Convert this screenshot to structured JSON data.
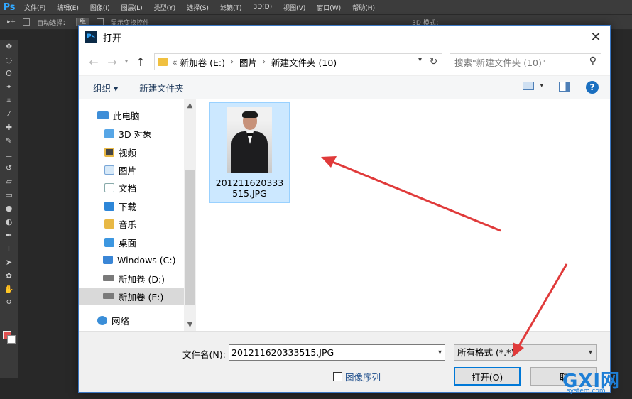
{
  "photoshop": {
    "logo": "Ps",
    "menu": [
      "文件(F)",
      "编辑(E)",
      "图像(I)",
      "图层(L)",
      "类型(Y)",
      "选择(S)",
      "滤镜(T)",
      "3D(D)",
      "视图(V)",
      "窗口(W)",
      "帮助(H)"
    ],
    "options": {
      "auto_select": "自动选择：",
      "auto_select_value": "组",
      "transform": "显示变换控件",
      "mode3d": "3D 模式："
    },
    "colors": {
      "foreground": "#e05050",
      "background": "#ffffff"
    }
  },
  "dialog": {
    "title": "打开",
    "close": "✕",
    "address": {
      "prefix": "«",
      "crumbs": [
        "新加卷 (E:)",
        "图片",
        "新建文件夹 (10)"
      ]
    },
    "search_placeholder": "搜索\"新建文件夹 (10)\"",
    "toolbar": {
      "organize": "组织 ▾",
      "new_folder": "新建文件夹",
      "help": "?"
    },
    "nav": {
      "items": [
        {
          "label": "此电脑",
          "icon": "computer-icon"
        },
        {
          "label": "3D 对象",
          "icon": "3d-objects-icon"
        },
        {
          "label": "视频",
          "icon": "video-icon"
        },
        {
          "label": "图片",
          "icon": "pictures-icon"
        },
        {
          "label": "文档",
          "icon": "documents-icon"
        },
        {
          "label": "下载",
          "icon": "downloads-icon"
        },
        {
          "label": "音乐",
          "icon": "music-icon"
        },
        {
          "label": "桌面",
          "icon": "desktop-icon"
        },
        {
          "label": "Windows (C:)",
          "icon": "windows-drive-icon"
        },
        {
          "label": "新加卷 (D:)",
          "icon": "drive-icon"
        },
        {
          "label": "新加卷 (E:)",
          "icon": "drive-icon",
          "selected": true
        },
        {
          "label": "网络",
          "icon": "network-icon"
        }
      ]
    },
    "files": [
      {
        "name": "201211620333515.JPG",
        "selected": true
      }
    ],
    "footer": {
      "filename_label": "文件名(N):",
      "filename_value": "201211620333515.JPG",
      "filter_value": "所有格式 (*.*)",
      "sequence_label": "图像序列",
      "open_button": "打开(O)",
      "cancel_button": "取"
    }
  },
  "watermark": {
    "main": "GXI网",
    "sub": "system.com"
  }
}
